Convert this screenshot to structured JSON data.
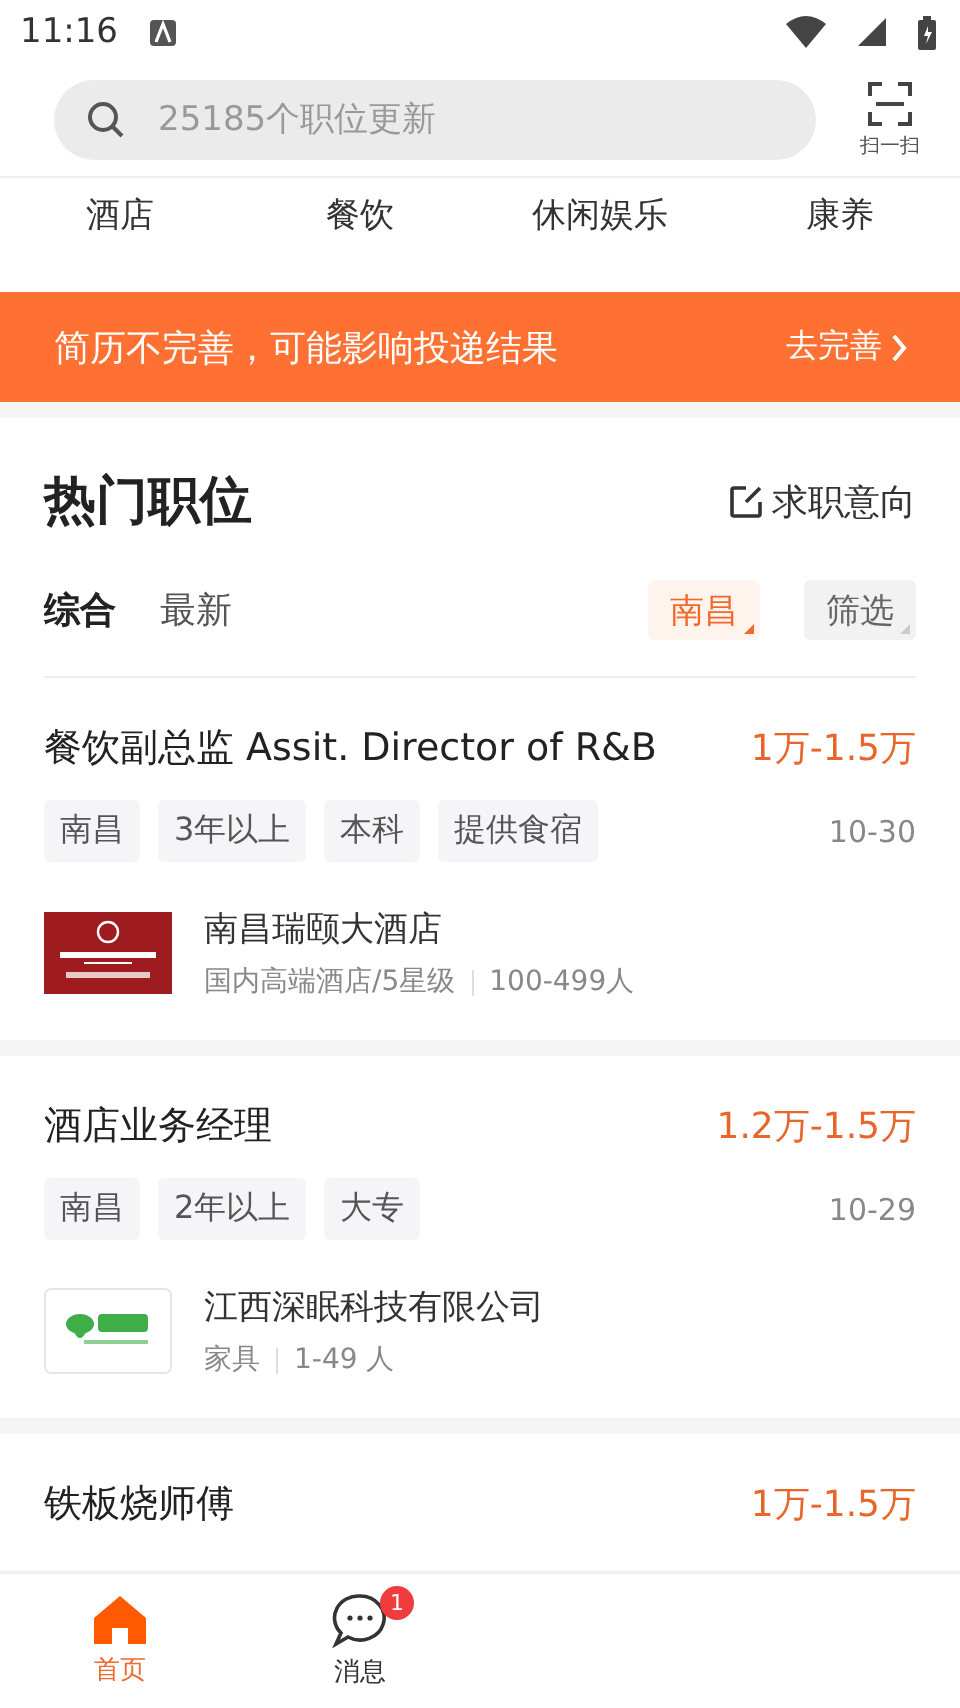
{
  "status_bar": {
    "time": "11:16"
  },
  "search": {
    "placeholder": "25185个职位更新"
  },
  "scan": {
    "label": "扫一扫"
  },
  "categories": [
    "酒店",
    "餐饮",
    "休闲娱乐",
    "康养"
  ],
  "banner": {
    "text": "简历不完善，可能影响投递结果",
    "action": "去完善"
  },
  "section": {
    "title": "热门职位",
    "action": "求职意向"
  },
  "sort_tabs": [
    {
      "label": "综合",
      "selected": true
    },
    {
      "label": "最新",
      "selected": false
    }
  ],
  "filters": [
    {
      "label": "南昌",
      "active": true
    },
    {
      "label": "筛选",
      "active": false
    }
  ],
  "jobs": [
    {
      "title": "餐饮副总监 Assit. Director of R&B",
      "salary": "1万-1.5万",
      "tags": [
        "南昌",
        "3年以上",
        "本科",
        "提供食宿"
      ],
      "date": "10-30",
      "company": {
        "name": "南昌瑞颐大酒店",
        "industry": "国内高端酒店/5星级",
        "size": "100-499人",
        "kind": "red"
      }
    },
    {
      "title": "酒店业务经理",
      "salary": "1.2万-1.5万",
      "tags": [
        "南昌",
        "2年以上",
        "大专"
      ],
      "date": "10-29",
      "company": {
        "name": "江西深眠科技有限公司",
        "industry": "家具",
        "size": "1-49 人",
        "kind": "green"
      }
    },
    {
      "title": "铁板烧师傅",
      "salary": "1万-1.5万"
    }
  ],
  "bottom_nav": [
    {
      "label": "首页",
      "kind": "home",
      "selected": true
    },
    {
      "label": "消息",
      "kind": "chat",
      "selected": false,
      "badge": "1"
    }
  ]
}
